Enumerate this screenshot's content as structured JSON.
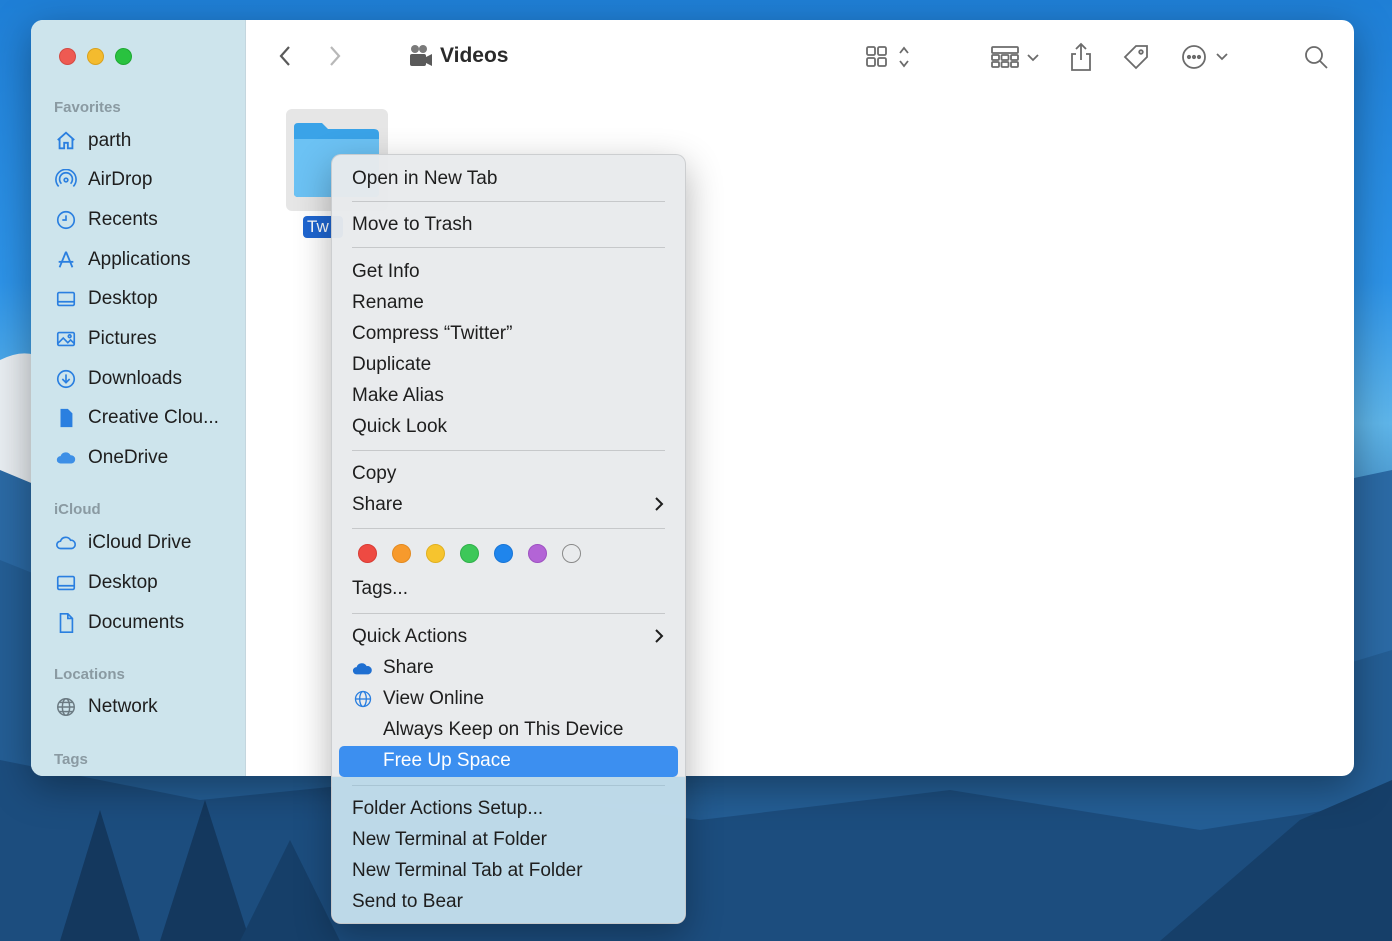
{
  "window": {
    "title": "Videos",
    "folder_label": "Tw"
  },
  "sidebar": {
    "favorites_header": "Favorites",
    "favorites": [
      {
        "label": "parth",
        "icon": "house-icon"
      },
      {
        "label": "AirDrop",
        "icon": "airdrop-icon"
      },
      {
        "label": "Recents",
        "icon": "clock-icon"
      },
      {
        "label": "Applications",
        "icon": "applications-icon"
      },
      {
        "label": "Desktop",
        "icon": "desktop-icon"
      },
      {
        "label": "Pictures",
        "icon": "pictures-icon"
      },
      {
        "label": "Downloads",
        "icon": "downloads-icon"
      },
      {
        "label": "Creative Clou...",
        "icon": "document-icon"
      },
      {
        "label": "OneDrive",
        "icon": "onedrive-cloud-icon"
      }
    ],
    "icloud_header": "iCloud",
    "icloud": [
      {
        "label": "iCloud Drive",
        "icon": "icloud-icon"
      },
      {
        "label": "Desktop",
        "icon": "desktop-icon"
      },
      {
        "label": "Documents",
        "icon": "document-icon"
      }
    ],
    "locations_header": "Locations",
    "locations": [
      {
        "label": "Network",
        "icon": "globe-icon"
      }
    ],
    "tags_header": "Tags"
  },
  "context_menu": {
    "open_new_tab": "Open in New Tab",
    "move_to_trash": "Move to Trash",
    "get_info": "Get Info",
    "rename": "Rename",
    "compress": "Compress “Twitter”",
    "duplicate": "Duplicate",
    "make_alias": "Make Alias",
    "quick_look": "Quick Look",
    "copy": "Copy",
    "share": "Share",
    "tags": "Tags...",
    "tag_colors": [
      "#ee4a42",
      "#f79a2c",
      "#f6c42e",
      "#3dc859",
      "#1f85ec",
      "#b364d6",
      "none"
    ],
    "quick_actions": "Quick Actions",
    "onedrive_share": "Share",
    "view_online": "View Online",
    "always_keep": "Always Keep on This Device",
    "free_up_space": "Free Up Space",
    "folder_actions": "Folder Actions Setup...",
    "new_terminal": "New Terminal at Folder",
    "new_terminal_tab": "New Terminal Tab at Folder",
    "send_to_bear": "Send to Bear"
  }
}
